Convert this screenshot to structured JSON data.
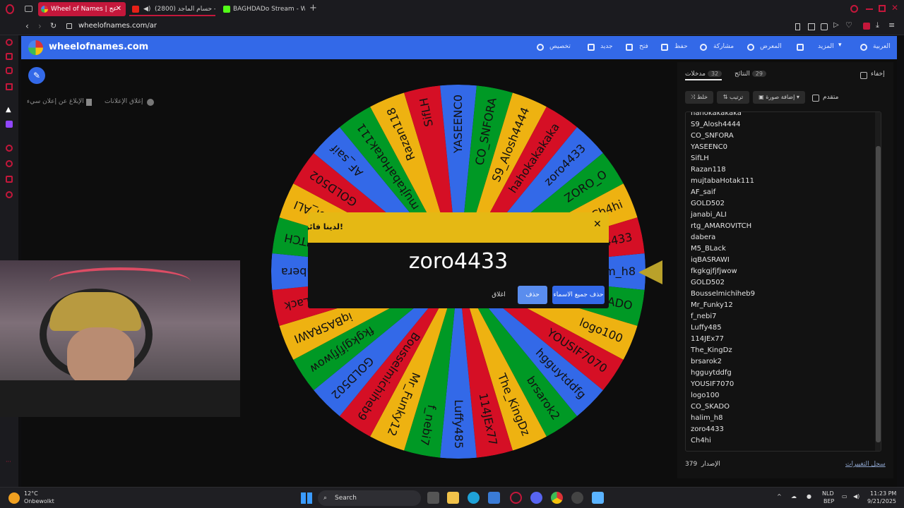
{
  "browser": {
    "tabs": [
      {
        "title": "Wheel of Names | عج"
      },
      {
        "title": "حسام الماجد (2800) - ..."
      },
      {
        "title": "BAGHDADo Stream - Wa"
      }
    ],
    "url": "wheelofnames.com/ar"
  },
  "site": {
    "logo_text": "wheelofnames.com",
    "nav": {
      "customize": "تخصيص",
      "new": "جديد",
      "open": "فتح",
      "save": "حفظ",
      "share": "مشاركة",
      "gallery": "المعرض",
      "more": "المزيد",
      "language": "العربية"
    },
    "ad_remove": "إغلاق الإعلانات",
    "ad_report": "الإبلاغ عن إعلان سيء"
  },
  "wheel": {
    "segments": [
      "halim_h8",
      "CO_SKADO",
      "logo100",
      "YOUSIF7070",
      "hgguytddfg",
      "brsarok2",
      "The_KingDz",
      "114JEx77",
      "Luffy485",
      "f_nebi7",
      "Mr_Funky12",
      "Bousselmichiheb9",
      "GOLD502",
      "fkgkgjfjfjwow",
      "iqBASRAWI",
      "M5_BLack",
      "dabera",
      "rtg_AMAROVITCH",
      "janabi_ALI",
      "GOLD502",
      "AF_saif",
      "mujtabaHotak111",
      "Razan118",
      "SifLH",
      "YASEENC0",
      "CO_SNFORA",
      "S9_Alosh4444",
      "hahokakakaka",
      "zoro4433",
      "ZORO_O",
      "Ch4hi",
      "zoro4433"
    ],
    "colors": [
      "#3369e8",
      "#009925",
      "#eeb211",
      "#d50f25"
    ]
  },
  "dialog": {
    "title": "لدينا فائز!",
    "winner": "zoro4433",
    "close_label": "اغلاق",
    "remove_label": "حذف",
    "remove_all_label": "حذف جميع الاسماء"
  },
  "panel": {
    "tab_entries": "مدخلات",
    "entries_count": "32",
    "tab_results": "النتائج",
    "results_count": "29",
    "hide_label": "إخفاء",
    "shuffle_label": "خلط",
    "sort_label": "ترتيب",
    "image_label": "إضافة صورة",
    "advanced_label": "متقدم",
    "entries": [
      "hahokakakaka",
      "S9_Alosh4444",
      "CO_SNFORA",
      "YASEENC0",
      "SifLH",
      "Razan118",
      "mujtabaHotak111",
      "AF_saif",
      "GOLD502",
      "janabi_ALI",
      "rtg_AMAROVITCH",
      "dabera",
      "M5_BLack",
      "iqBASRAWI",
      "fkgkgjfjfjwow",
      "GOLD502",
      "Bousselmichiheb9",
      "Mr_Funky12",
      "f_nebi7",
      "Luffy485",
      "114JEx77",
      "The_KingDz",
      "brsarok2",
      "hgguytddfg",
      "YOUSIF7070",
      "logo100",
      "CO_SKADO",
      "halim_h8",
      "zoro4433",
      "Ch4hi"
    ],
    "version_label": "الإصدار",
    "version_number": "379",
    "changelog_label": "سجل التغييرات"
  },
  "taskbar": {
    "weather_temp": "12°C",
    "weather_desc": "Onbewolkt",
    "search_label": "Search",
    "lang_top": "NLD",
    "lang_bottom": "BEP",
    "time": "11:23 PM",
    "date": "9/21/2025"
  }
}
